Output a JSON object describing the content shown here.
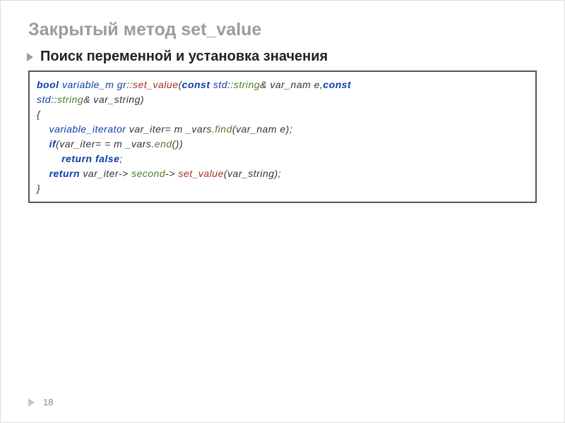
{
  "title": "Закрытый метод set_value",
  "subtitle": "Поиск переменной и установка значения",
  "page": "18",
  "code": {
    "sig_bool": "bool",
    "sig_class": "variable_m gr",
    "sig_fn": "set_value",
    "sig_const1": "const",
    "sig_std1": "std",
    "sig_string1": "string",
    "sig_amp1": "& var_nam e,",
    "sig_const2": "const",
    "sig_std2": "std",
    "sig_string2": "string",
    "sig_amp2": "& var_string)",
    "brace_open": "{",
    "l1_type": "variable_iterator",
    "l1_rest": "var_iter= m _vars.",
    "l1_find": "find",
    "l1_end": "(var_nam e);",
    "l2_if": "if",
    "l2_cond": "(var_iter= = m _vars.",
    "l2_end_kw": "end",
    "l2_tail": "())",
    "l3_return": "return",
    "l3_false": " false",
    "l3_semi": ";",
    "l4_return": "return",
    "l4_a": " var_iter-> ",
    "l4_second": "second",
    "l4_b": "-> ",
    "l4_setv": "set_value",
    "l4_c": "(var_string);",
    "brace_close": "}"
  }
}
